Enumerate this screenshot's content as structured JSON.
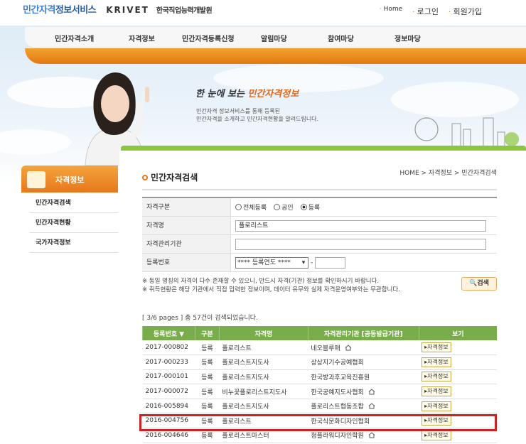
{
  "header": {
    "brand": "민간자격",
    "brand2": "정보서비스",
    "krivet": "KRIVET",
    "org": "한국직업능력개발원",
    "links": [
      "Home",
      "로그인",
      "회원가입"
    ]
  },
  "nav": [
    "민간자격소개",
    "자격정보",
    "민간자격등록신청",
    "알림마당",
    "참여마당",
    "정보마당"
  ],
  "hero": {
    "title_a": "한 눈에 보는 ",
    "title_b": "민간자격정보",
    "sub1": "민간자격 정보서비스를 통해 등록된",
    "sub2": "민간자격을 소개하고 민간자격현황을 알려드립니다."
  },
  "sidebar": {
    "title": "자격정보",
    "items": [
      "민간자격검색",
      "민간자격현황",
      "국가자격정보"
    ]
  },
  "page": {
    "title": "민간자격검색",
    "breadcrumb": "HOME > 자격정보 > 민간자격검색"
  },
  "form": {
    "type_label": "자격구분",
    "types": [
      "전체등록",
      "공인",
      "등록"
    ],
    "selected_type": "등록",
    "name_label": "자격명",
    "name_value": "플로리스트",
    "agency_label": "자격관리기관",
    "agency_value": "",
    "regno_label": "등록번호",
    "regno_select": "**** 등록연도 ****",
    "regno_sep": "-",
    "regno_value": ""
  },
  "notes": [
    "※ 동일 명칭의 자격이 다수 존재할 수 있으니, 반드시 자격(기관) 정보를 확인하시기 바랍니다.",
    "※ 취득현황은 해당 기관에서 직접 입력한 정보이며, 데이터 유무와 실제 자격운영여부와는 무관합니다."
  ],
  "search_button": "검색",
  "result_count": "[ 3/6 pages ] 총 57건이 검색되었습니다.",
  "table": {
    "headers": [
      "등록번호 ▼",
      "구분",
      "자격명",
      "자격관리기관 [공동발급기관]",
      "보기"
    ],
    "view_label": "▸자격정보",
    "rows": [
      {
        "no": "2017-000802",
        "type": "등록",
        "name": "플로리스트",
        "agency": "네오블루매",
        "home": true
      },
      {
        "no": "2017-000233",
        "type": "등록",
        "name": "플로리스트지도사",
        "agency": "상상지기수공예협회",
        "home": false
      },
      {
        "no": "2017-000101",
        "type": "등록",
        "name": "플로리스트지도사",
        "agency": "한국방과후교육진흥원",
        "home": false
      },
      {
        "no": "2017-000072",
        "type": "등록",
        "name": "비누꽃플로리스트지도사",
        "agency": "한국공예지도사협회",
        "home": true
      },
      {
        "no": "2016-005894",
        "type": "등록",
        "name": "플로리스트지도사",
        "agency": "플로리스트협동조합",
        "home": true
      },
      {
        "no": "2016-004756",
        "type": "등록",
        "name": "플로리스트",
        "agency": "한국식문화디자인협회",
        "home": false
      },
      {
        "no": "2016-004646",
        "type": "등록",
        "name": "플로리스트마스터",
        "agency": "청플라워디자인학원",
        "home": true
      }
    ]
  }
}
